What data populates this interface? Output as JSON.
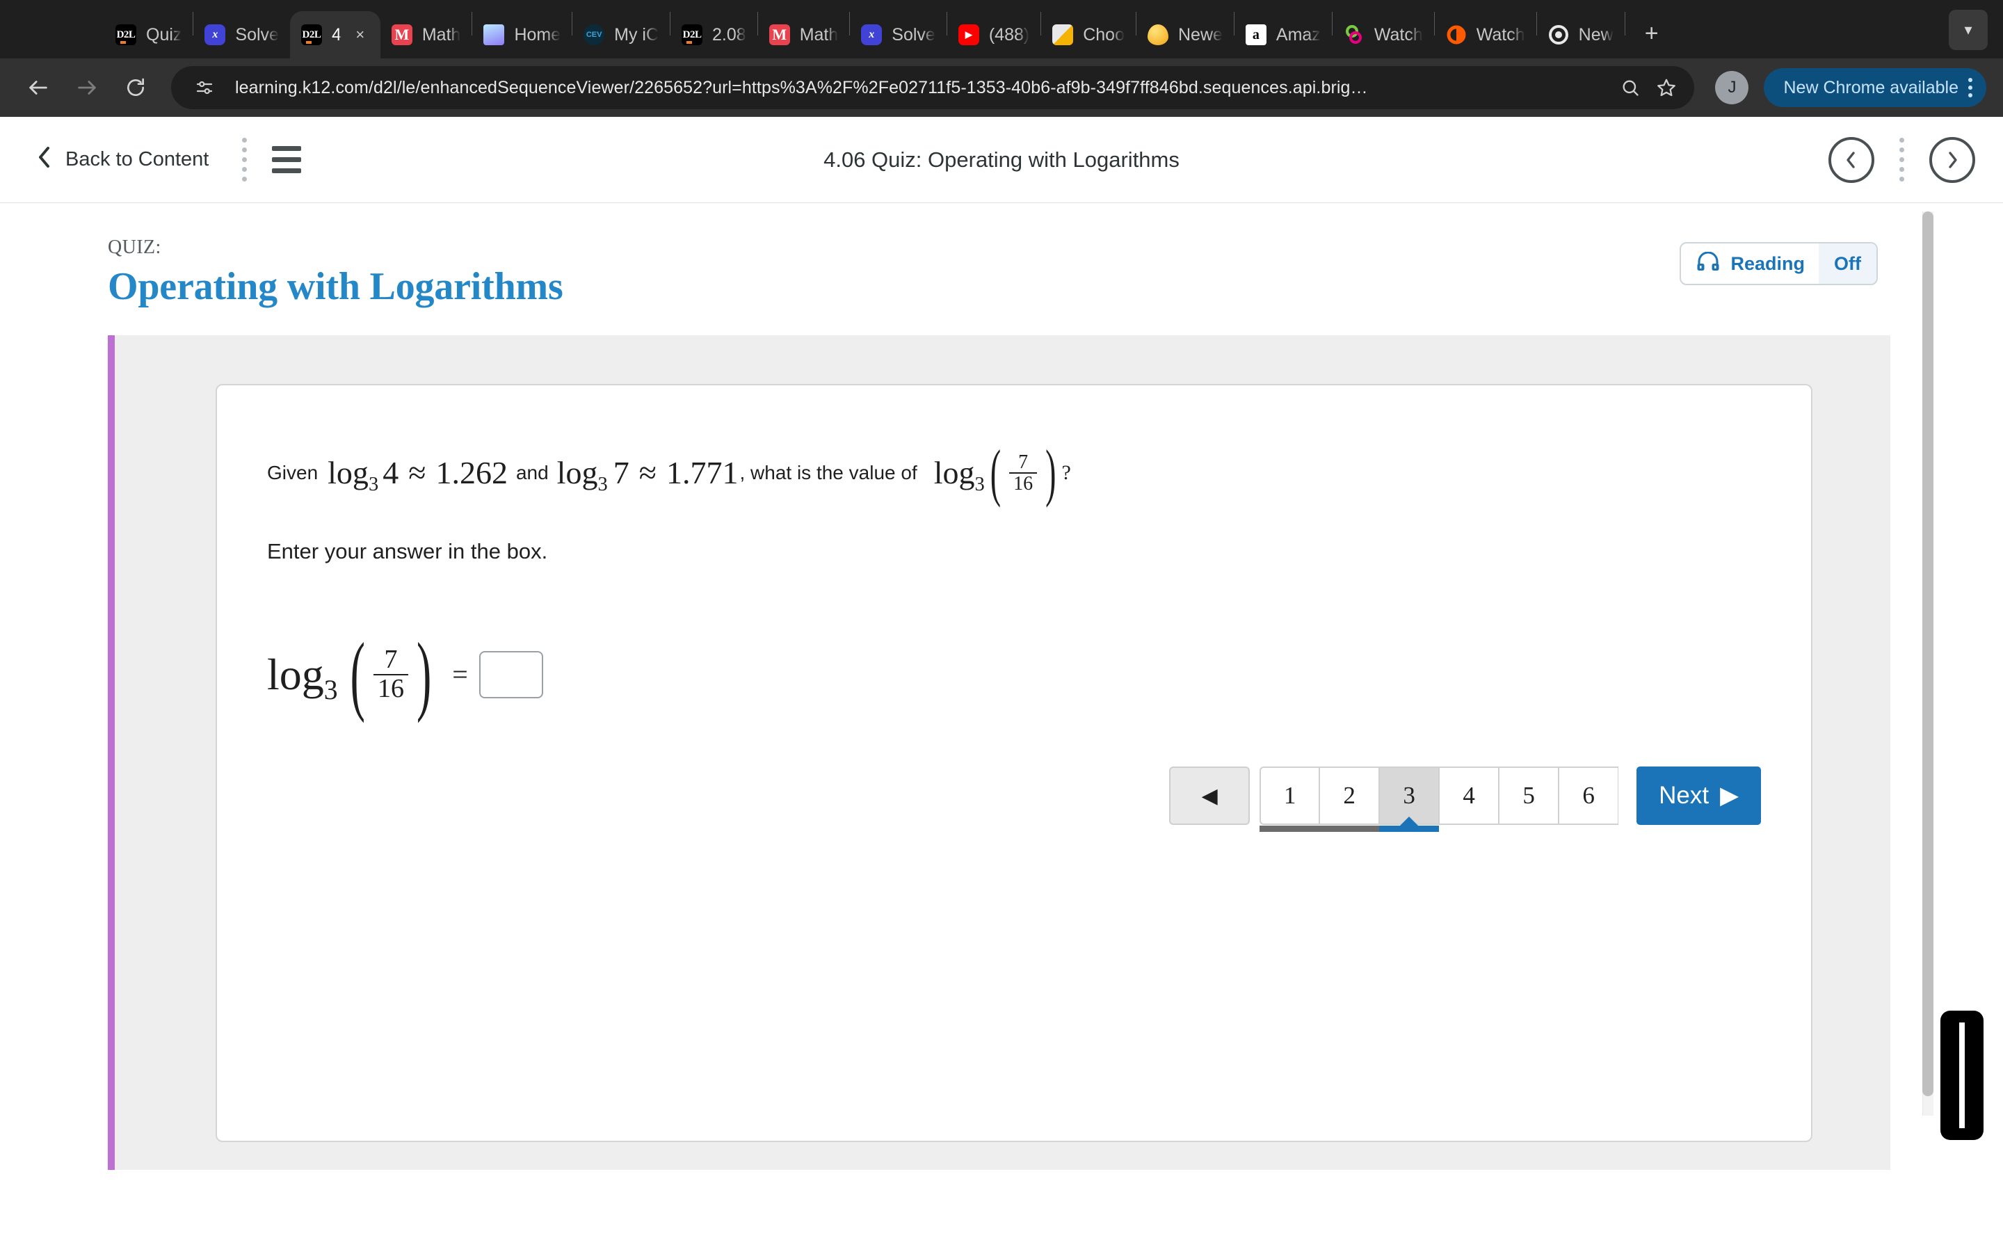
{
  "browser": {
    "tabs": [
      {
        "title": "Quiz",
        "favicon": "d2l-icon",
        "active": false
      },
      {
        "title": "Solve",
        "favicon": "symbolab-icon",
        "active": false
      },
      {
        "title": "4",
        "favicon": "d2l-icon",
        "active": true
      },
      {
        "title": "Math",
        "favicon": "mathway-icon",
        "active": false
      },
      {
        "title": "Home",
        "favicon": "home-icon",
        "active": false
      },
      {
        "title": "My iC",
        "favicon": "cev-icon",
        "active": false
      },
      {
        "title": "2.08",
        "favicon": "d2l-icon",
        "active": false
      },
      {
        "title": "Math",
        "favicon": "mathway-icon",
        "active": false
      },
      {
        "title": "Solve",
        "favicon": "symbolab-icon",
        "active": false
      },
      {
        "title": "(488)",
        "favicon": "youtube-icon",
        "active": false
      },
      {
        "title": "Choo",
        "favicon": "box-icon",
        "active": false
      },
      {
        "title": "Newe",
        "favicon": "egg-icon",
        "active": false
      },
      {
        "title": "Amaz",
        "favicon": "amazon-icon",
        "active": false
      },
      {
        "title": "Watch",
        "favicon": "watch-green-icon",
        "active": false
      },
      {
        "title": "Watch",
        "favicon": "watch-orange-icon",
        "active": false
      },
      {
        "title": "New",
        "favicon": "chrome-icon",
        "active": false
      }
    ],
    "new_tab_label": "+",
    "tab_close_label": "×",
    "tab_list_chevron": "chevron-down-icon",
    "toolbar": {
      "back_label": "←",
      "forward_label": "→",
      "reload_label": "↻",
      "url": "learning.k12.com/d2l/le/enhancedSequenceViewer/2265652?url=https%3A%2F%2Fe02711f5-1353-40b6-af9b-349f7ff846bd.sequences.api.brig…",
      "site_info_icon": "tune-icon",
      "zoom_icon": "zoom-icon",
      "bookmark_icon": "star-icon",
      "profile_initial": "J",
      "update_label": "New Chrome available",
      "menu_icon": "kebab-menu-icon"
    }
  },
  "app_header": {
    "back_label": "Back to Content",
    "back_icon": "chevron-left-icon",
    "drag_handle_icon": "vertical-dots-icon",
    "menu_icon": "hamburger-icon",
    "title": "4.06 Quiz: Operating with Logarithms",
    "prev_icon": "circle-chevron-left-icon",
    "next_icon": "circle-chevron-right-icon",
    "right_dots_icon": "vertical-dots-icon"
  },
  "quiz": {
    "kicker": "QUIZ:",
    "title": "Operating with Logarithms",
    "reading": {
      "icon": "headphones-icon",
      "label": "Reading",
      "state": "Off"
    },
    "question": {
      "lead_word": "Given",
      "log_a_base": "3",
      "log_a_arg": "4",
      "approx": "≈",
      "value_a": "1.262",
      "and_word": "and",
      "log_b_base": "3",
      "log_b_arg": "7",
      "value_b": "1.771",
      "mid_text": ", what is the value of",
      "target_log_base": "3",
      "target_numerator": "7",
      "target_denominator": "16",
      "question_mark": "?",
      "instruction": "Enter your answer in the box."
    },
    "answer": {
      "log_label": "log",
      "base": "3",
      "numerator": "7",
      "denominator": "16",
      "equals": "=",
      "value": "",
      "placeholder": ""
    },
    "pager": {
      "prev_icon": "triangle-left-icon",
      "pages": [
        "1",
        "2",
        "3",
        "4",
        "5",
        "6"
      ],
      "current": "3",
      "completed_count": 2,
      "next_label": "Next",
      "next_icon": "triangle-right-icon"
    }
  },
  "colors": {
    "accent_blue": "#1b74b8",
    "title_blue": "#2488c8",
    "accent_purple": "#bd6fd4",
    "panel_gray": "#eeeeee",
    "progress_done": "#6c6c6c"
  }
}
